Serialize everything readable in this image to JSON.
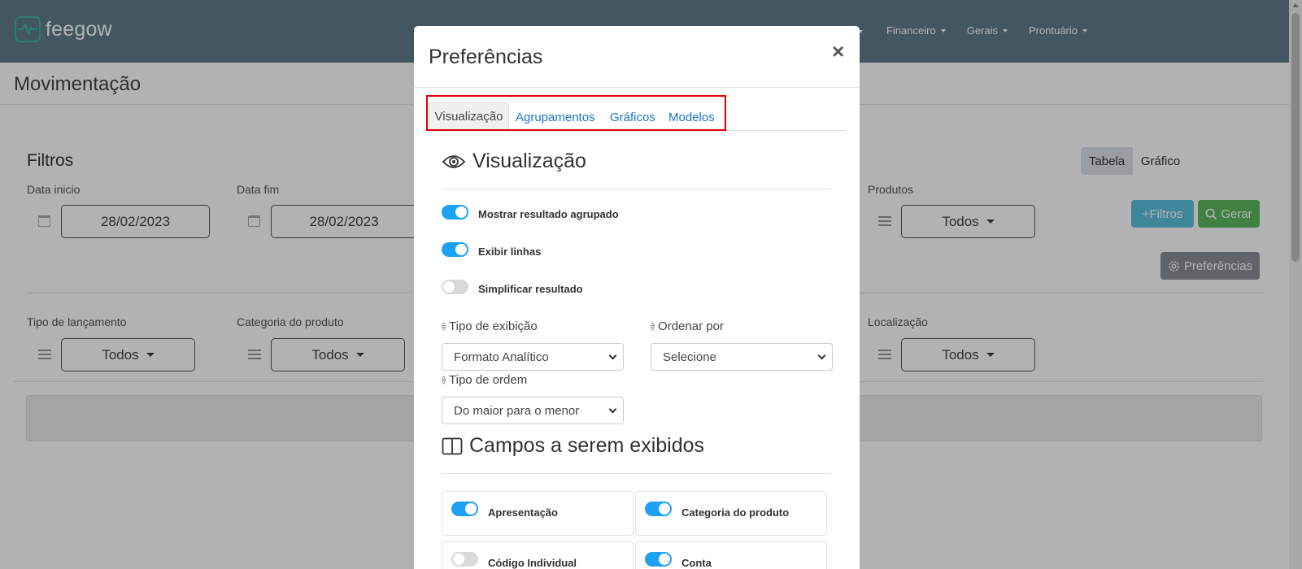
{
  "app": {
    "brand": "feegow"
  },
  "navbar": {
    "items": [
      {
        "label": "Financeiro"
      },
      {
        "label": "Gerais"
      },
      {
        "label": "Prontuário"
      }
    ]
  },
  "page": {
    "title": "Movimentação",
    "filters_title": "Filtros"
  },
  "filters": {
    "data_inicio": {
      "label": "Data inicio",
      "value": "28/02/2023"
    },
    "data_fim": {
      "label": "Data fim",
      "value": "28/02/2023"
    },
    "produtos": {
      "label": "Produtos",
      "value": "Todos"
    },
    "tipo_lancamento": {
      "label": "Tipo de lançamento",
      "value": "Todos"
    },
    "categoria_produto": {
      "label": "Categoria do produto",
      "value": "Todos"
    },
    "localizacao": {
      "label": "Localização",
      "value": "Todos"
    }
  },
  "view_toggle": {
    "tabela": "Tabela",
    "grafico": "Gráfico"
  },
  "buttons": {
    "filtros": "Filtros",
    "gerar": "Gerar",
    "preferencias": "Preferências"
  },
  "modal": {
    "title": "Preferências",
    "close": "×",
    "tabs": [
      {
        "label": "Visualização"
      },
      {
        "label": "Agrupamentos"
      },
      {
        "label": "Gráficos"
      },
      {
        "label": "Modelos"
      }
    ],
    "section_visualizacao": "Visualização",
    "toggles": [
      {
        "label": "Mostrar resultado agrupado",
        "on": true
      },
      {
        "label": "Exibir linhas",
        "on": true
      },
      {
        "label": "Simplificar resultado",
        "on": false
      }
    ],
    "tipo_exibicao": {
      "label": "Tipo de exibição",
      "value": "Formato Analítico"
    },
    "ordenar_por": {
      "label": "Ordenar por",
      "value": "Selecione"
    },
    "tipo_ordem": {
      "label": "Tipo de ordem",
      "value": "Do maior para o menor"
    },
    "section_campos": "Campos a serem exibidos",
    "fields": [
      {
        "label": "Apresentação",
        "on": true
      },
      {
        "label": "Categoria do produto",
        "on": true
      },
      {
        "label": "Código Individual",
        "on": false
      },
      {
        "label": "Conta",
        "on": true
      }
    ]
  },
  "colors": {
    "navbar": "#5f7d8c",
    "toggle_on": "#1da1f2",
    "link": "#1a73c8",
    "highlight": "#e00000"
  }
}
